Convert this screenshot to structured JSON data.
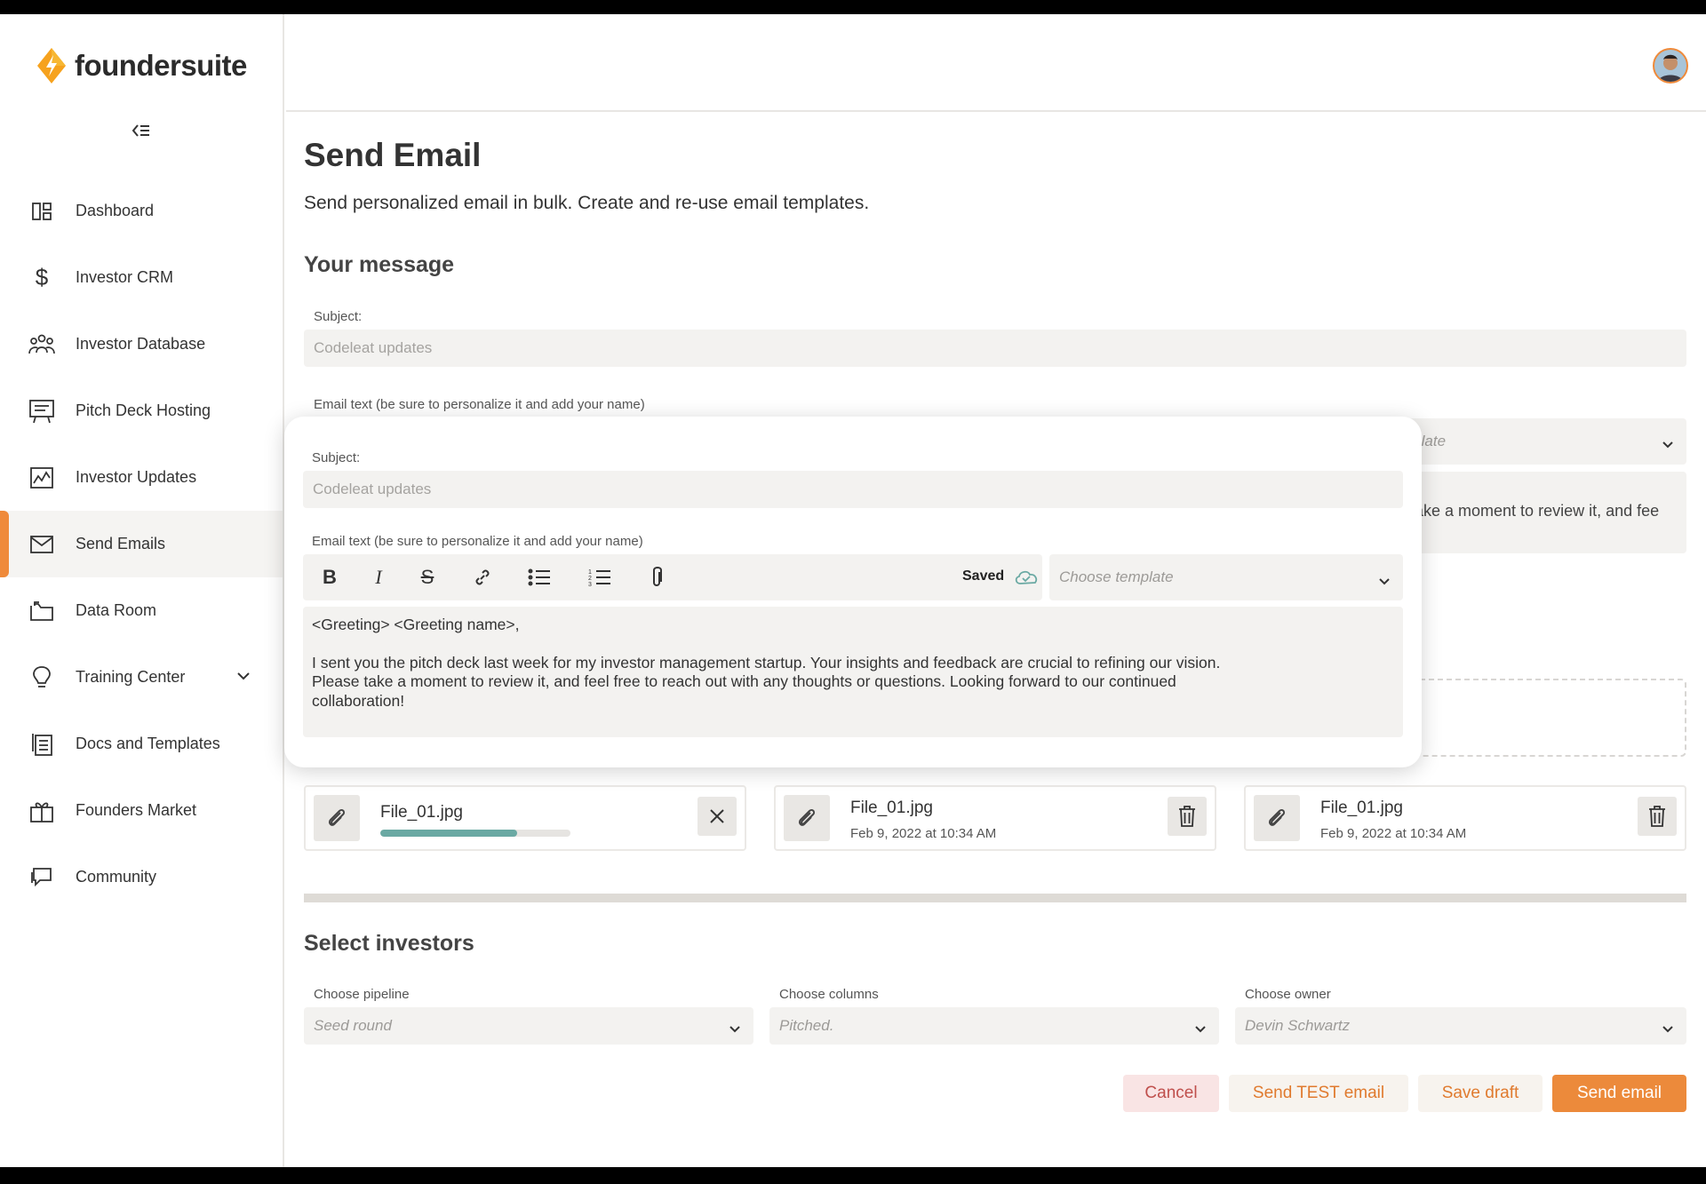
{
  "brand": {
    "name": "foundersuite"
  },
  "sidebar": {
    "items": [
      {
        "label": "Dashboard",
        "icon": "dashboard-icon"
      },
      {
        "label": "Investor CRM",
        "icon": "dollar-icon"
      },
      {
        "label": "Investor Database",
        "icon": "people-icon"
      },
      {
        "label": "Pitch Deck Hosting",
        "icon": "presentation-icon"
      },
      {
        "label": "Investor Updates",
        "icon": "chart-icon"
      },
      {
        "label": "Send Emails",
        "icon": "mail-icon",
        "active": true
      },
      {
        "label": "Data Room",
        "icon": "folder-icon"
      },
      {
        "label": "Training Center",
        "icon": "lightbulb-icon"
      },
      {
        "label": "Docs and Templates",
        "icon": "documents-icon"
      },
      {
        "label": "Founders Market",
        "icon": "gift-icon"
      },
      {
        "label": "Community",
        "icon": "chat-icon"
      }
    ]
  },
  "page": {
    "title": "Send Email",
    "subtitle": "Send personalized email in bulk. Create and re-use email templates.",
    "message_section": "Your message",
    "subject_label": "Subject:",
    "subject_placeholder": "Codeleat updates",
    "email_text_label": "Email text (be sure to personalize it and add your name)",
    "template_partial": "mplate",
    "body_partial": "ake a moment to review it, and fee"
  },
  "modal": {
    "subject_label": "Subject:",
    "subject_placeholder": "Codeleat updates",
    "email_text_label": "Email text (be sure to personalize it and add your name)",
    "saved_label": "Saved",
    "template_placeholder": "Choose template",
    "body": {
      "greeting": "<Greeting> <Greeting name>,",
      "paragraph_line1": "I sent you the pitch deck last week for my investor management startup. Your insights and feedback are crucial to refining our vision.",
      "paragraph_line2": "Please take a moment to review it, and feel free to reach out with any thoughts or questions. Looking forward to our continued",
      "paragraph_line3": "collaboration!"
    }
  },
  "attachments": [
    {
      "name": "File_01.jpg",
      "uploading": true,
      "progress": 0.72
    },
    {
      "name": "File_01.jpg",
      "date": "Feb 9, 2022 at 10:34 AM"
    },
    {
      "name": "File_01.jpg",
      "date": "Feb 9, 2022 at 10:34 AM"
    }
  ],
  "investors": {
    "title": "Select investors",
    "pipeline_label": "Choose pipeline",
    "pipeline_value": "Seed round",
    "columns_label": "Choose columns",
    "columns_value": "Pitched.",
    "owner_label": "Choose owner",
    "owner_value": "Devin Schwartz"
  },
  "actions": {
    "cancel": "Cancel",
    "send_test": "Send TEST email",
    "save_draft": "Save draft",
    "send": "Send email"
  },
  "colors": {
    "accent": "#ec8a3b",
    "progress": "#6aa9a3",
    "saved_cloud": "#6aa9a3"
  }
}
